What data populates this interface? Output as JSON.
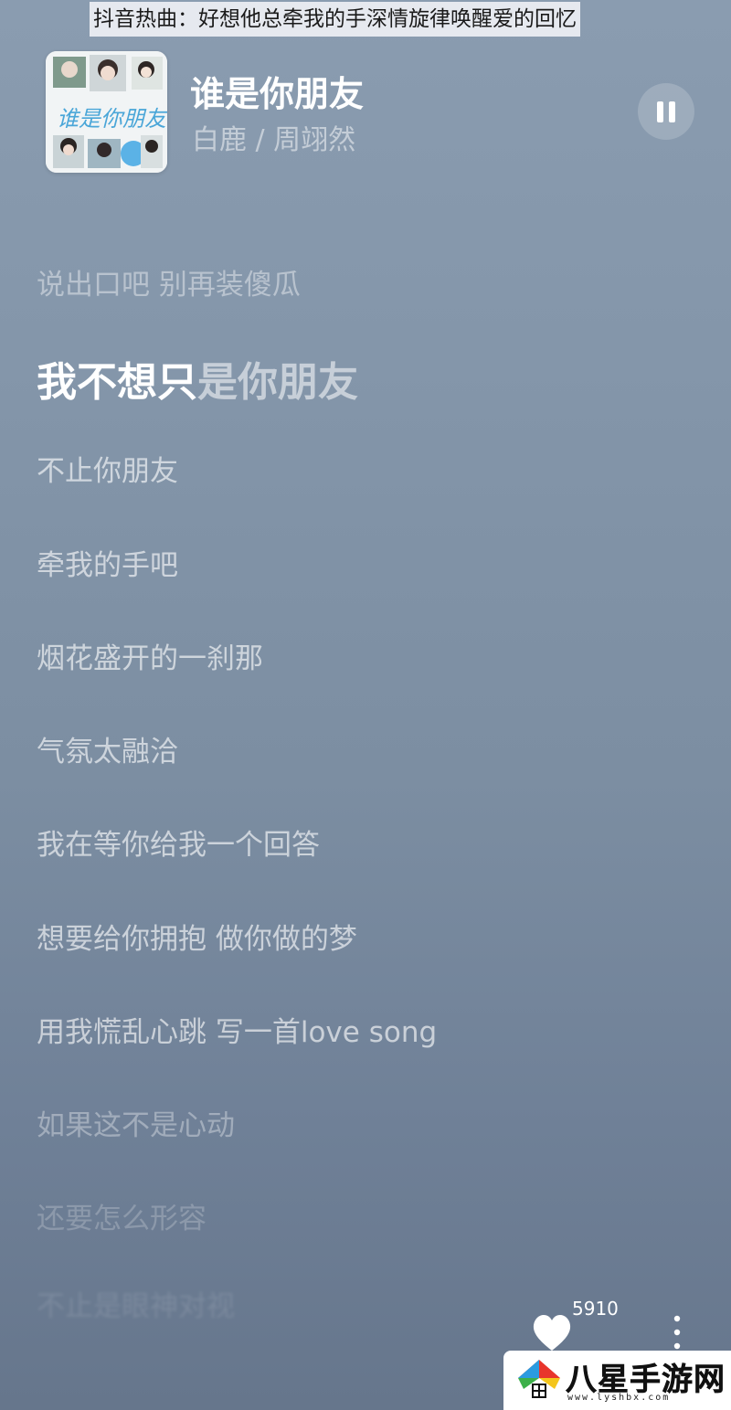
{
  "banner": {
    "text": "抖音热曲：好想他总牵我的手深情旋律唤醒爱的回忆"
  },
  "player": {
    "title": "谁是你朋友",
    "artist": "白鹿 / 周翊然"
  },
  "lyrics": {
    "previous": "说出口吧 别再装傻瓜",
    "current_sung": "我不想只",
    "current_unsung": "是你朋友",
    "upcoming": [
      "不止你朋友",
      "牵我的手吧",
      "烟花盛开的一刹那",
      "气氛太融洽",
      "我在等你给我一个回答",
      "想要给你拥抱 做你做的梦",
      "用我慌乱心跳 写一首love song",
      "如果这不是心动",
      "还要怎么形容",
      "不止是眼神对视"
    ]
  },
  "actions": {
    "like_count": "5910"
  },
  "watermark": {
    "text": "八星手游网",
    "url": "www.lyshbx.com"
  },
  "colors": {
    "background": "#8496aa",
    "current_line": "#ffffff"
  },
  "icons": [
    "pause-icon",
    "heart-icon",
    "more-vertical-icon",
    "album-cover"
  ]
}
